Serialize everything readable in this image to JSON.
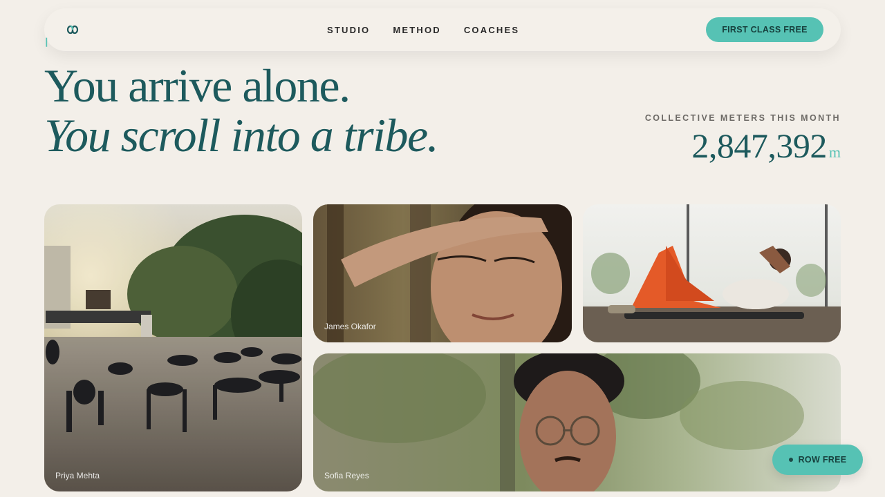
{
  "nav": {
    "logo_icon": "infinity-knot-icon",
    "links": [
      "STUDIO",
      "METHOD",
      "COACHES"
    ],
    "cta_label": "FIRST CLASS FREE"
  },
  "hero": {
    "line1": "You arrive alone.",
    "line2": "You scroll into a tribe."
  },
  "counter": {
    "label": "COLLECTIVE METERS THIS MONTH",
    "value": "2,847,392",
    "unit": "m"
  },
  "gallery": [
    {
      "caption": "Priya Mehta",
      "scene": "group-pushups-park"
    },
    {
      "caption": "James Okafor",
      "scene": "woman-eyes-closed"
    },
    {
      "caption": "",
      "scene": "woman-situps-mat"
    },
    {
      "caption": "Sofia Reyes",
      "scene": "man-glasses-portrait"
    }
  ],
  "floating_button": {
    "label": "ROW FREE"
  },
  "colors": {
    "background": "#f3efe9",
    "accent": "#56c2b4",
    "heading": "#1d5a5d"
  }
}
